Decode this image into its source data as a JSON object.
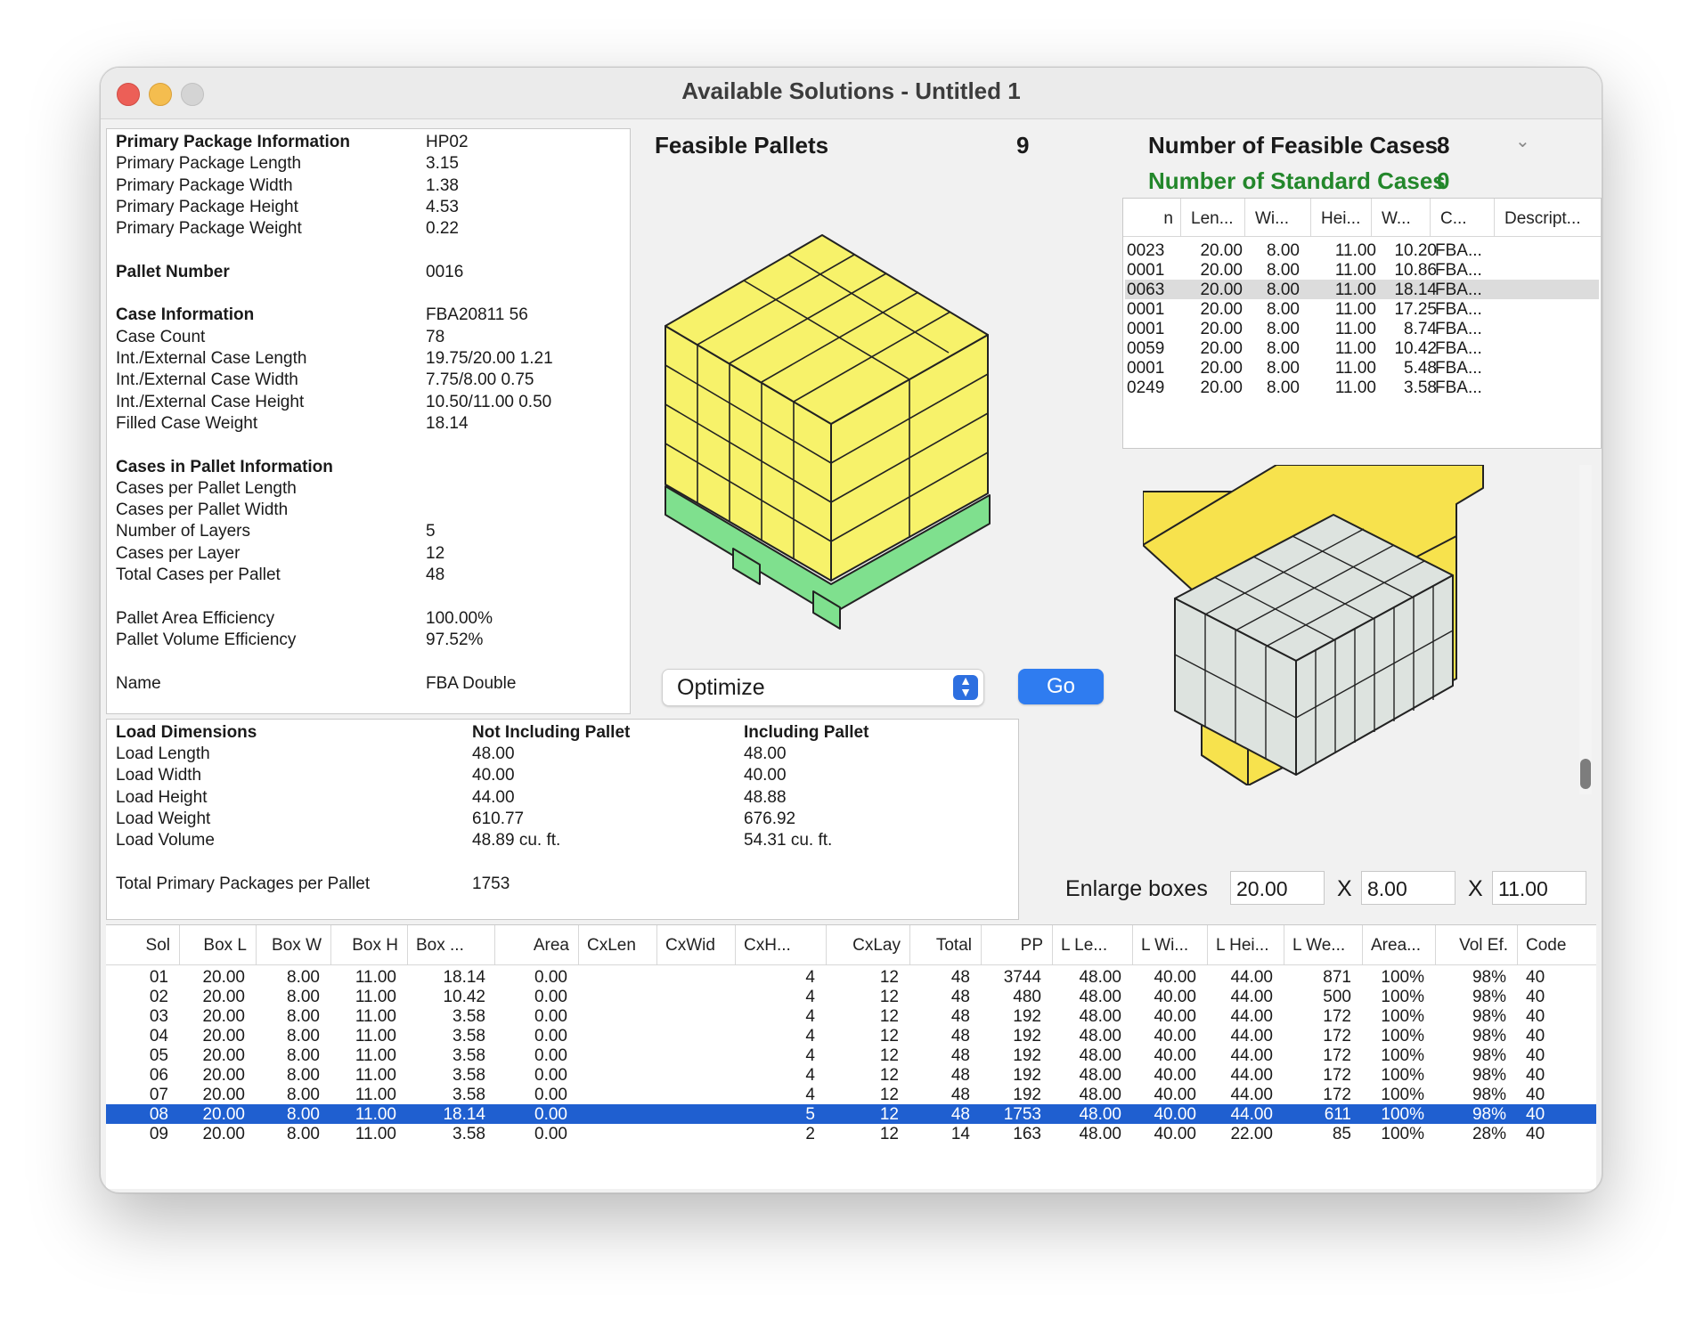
{
  "window": {
    "title": "Available Solutions - Untitled 1"
  },
  "info": [
    {
      "label": "Primary Package Information",
      "value": "HP02",
      "bold": true
    },
    {
      "label": "Primary Package Length",
      "value": "3.15"
    },
    {
      "label": "Primary Package Width",
      "value": "1.38"
    },
    {
      "label": "Primary Package Height",
      "value": "4.53"
    },
    {
      "label": "Primary Package Weight",
      "value": "0.22"
    },
    {
      "label": "",
      "value": ""
    },
    {
      "label": "Pallet Number",
      "value": "0016",
      "bold": true
    },
    {
      "label": "",
      "value": ""
    },
    {
      "label": "Case Information",
      "value": "FBA20811 56",
      "bold": true
    },
    {
      "label": "Case Count",
      "value": "78"
    },
    {
      "label": "Int./External Case Length",
      "value": "19.75/20.00   1.21"
    },
    {
      "label": "Int./External Case Width",
      "value": "7.75/8.00   0.75"
    },
    {
      "label": "Int./External Case Height",
      "value": "10.50/11.00   0.50"
    },
    {
      "label": "Filled Case Weight",
      "value": "18.14"
    },
    {
      "label": "",
      "value": ""
    },
    {
      "label": "Cases in Pallet Information",
      "value": "",
      "bold": true
    },
    {
      "label": "Cases per Pallet Length",
      "value": ""
    },
    {
      "label": "Cases per Pallet Width",
      "value": ""
    },
    {
      "label": "Number of Layers",
      "value": "5"
    },
    {
      "label": "Cases per Layer",
      "value": "12"
    },
    {
      "label": "Total Cases per Pallet",
      "value": "48"
    },
    {
      "label": "",
      "value": ""
    },
    {
      "label": "Pallet Area Efficiency",
      "value": "100.00%"
    },
    {
      "label": "Pallet Volume Efficiency",
      "value": "97.52%"
    },
    {
      "label": "",
      "value": ""
    },
    {
      "label": "Name",
      "value": "FBA Double"
    }
  ],
  "load": {
    "headers": [
      "Load Dimensions",
      "Not Including Pallet",
      "Including Pallet"
    ],
    "rows": [
      [
        "Load Length",
        "48.00",
        "48.00"
      ],
      [
        "Load Width",
        "40.00",
        "40.00"
      ],
      [
        "Load Height",
        "44.00",
        "48.88"
      ],
      [
        "Load Weight",
        "610.77",
        "676.92"
      ],
      [
        "Load Volume",
        "48.89 cu. ft.",
        "54.31 cu. ft."
      ],
      [
        "",
        "",
        ""
      ],
      [
        "Total Primary Packages per Pallet",
        "1753",
        ""
      ]
    ]
  },
  "feasible_pallets": {
    "label": "Feasible Pallets",
    "count": "9"
  },
  "feasible_cases": {
    "label": "Number of Feasible Cases",
    "count": "8"
  },
  "standard_cases": {
    "label": "Number of Standard Cases",
    "count": "0",
    "color": "#23872b"
  },
  "cases_table": {
    "headers": [
      "n",
      "Len...",
      "Wi...",
      "Hei...",
      "W...",
      "C...",
      "Descript..."
    ],
    "rows": [
      [
        "0023",
        "20.00",
        "8.00",
        "11.00",
        "10.20",
        "FBA..."
      ],
      [
        "0001",
        "20.00",
        "8.00",
        "11.00",
        "10.86",
        "FBA..."
      ],
      [
        "0063",
        "20.00",
        "8.00",
        "11.00",
        "18.14",
        "FBA..."
      ],
      [
        "0001",
        "20.00",
        "8.00",
        "11.00",
        "17.25",
        "FBA..."
      ],
      [
        "0001",
        "20.00",
        "8.00",
        "11.00",
        "8.74",
        "FBA..."
      ],
      [
        "0059",
        "20.00",
        "8.00",
        "11.00",
        "10.42",
        "FBA..."
      ],
      [
        "0001",
        "20.00",
        "8.00",
        "11.00",
        "5.48",
        "FBA..."
      ],
      [
        "0249",
        "20.00",
        "8.00",
        "11.00",
        "3.58",
        "FBA..."
      ]
    ],
    "selected_index": 2
  },
  "controls": {
    "mode": "Optimize",
    "go": "Go"
  },
  "enlarge": {
    "label": "Enlarge boxes",
    "x": "X",
    "length": "20.00",
    "width": "8.00",
    "height": "11.00"
  },
  "solutions": {
    "headers": [
      "Sol",
      "Box L",
      "Box W",
      "Box H",
      "Box ...",
      "Area",
      "CxLen",
      "CxWid",
      "CxH...",
      "CxLay",
      "Total",
      "PP",
      "L Le...",
      "L Wi...",
      "L Hei...",
      "L We...",
      "Area...",
      "Vol Ef.",
      "Code"
    ],
    "rows": [
      [
        "01",
        "20.00",
        "8.00",
        "11.00",
        "18.14",
        "0.00",
        "",
        "",
        "4",
        "12",
        "48",
        "3744",
        "48.00",
        "40.00",
        "44.00",
        "871",
        "100%",
        "98%",
        "40"
      ],
      [
        "02",
        "20.00",
        "8.00",
        "11.00",
        "10.42",
        "0.00",
        "",
        "",
        "4",
        "12",
        "48",
        "480",
        "48.00",
        "40.00",
        "44.00",
        "500",
        "100%",
        "98%",
        "40"
      ],
      [
        "03",
        "20.00",
        "8.00",
        "11.00",
        "3.58",
        "0.00",
        "",
        "",
        "4",
        "12",
        "48",
        "192",
        "48.00",
        "40.00",
        "44.00",
        "172",
        "100%",
        "98%",
        "40"
      ],
      [
        "04",
        "20.00",
        "8.00",
        "11.00",
        "3.58",
        "0.00",
        "",
        "",
        "4",
        "12",
        "48",
        "192",
        "48.00",
        "40.00",
        "44.00",
        "172",
        "100%",
        "98%",
        "40"
      ],
      [
        "05",
        "20.00",
        "8.00",
        "11.00",
        "3.58",
        "0.00",
        "",
        "",
        "4",
        "12",
        "48",
        "192",
        "48.00",
        "40.00",
        "44.00",
        "172",
        "100%",
        "98%",
        "40"
      ],
      [
        "06",
        "20.00",
        "8.00",
        "11.00",
        "3.58",
        "0.00",
        "",
        "",
        "4",
        "12",
        "48",
        "192",
        "48.00",
        "40.00",
        "44.00",
        "172",
        "100%",
        "98%",
        "40"
      ],
      [
        "07",
        "20.00",
        "8.00",
        "11.00",
        "3.58",
        "0.00",
        "",
        "",
        "4",
        "12",
        "48",
        "192",
        "48.00",
        "40.00",
        "44.00",
        "172",
        "100%",
        "98%",
        "40"
      ],
      [
        "08",
        "20.00",
        "8.00",
        "11.00",
        "18.14",
        "0.00",
        "",
        "",
        "5",
        "12",
        "48",
        "1753",
        "48.00",
        "40.00",
        "44.00",
        "611",
        "100%",
        "98%",
        "40"
      ],
      [
        "09",
        "20.00",
        "8.00",
        "11.00",
        "3.58",
        "0.00",
        "",
        "",
        "2",
        "12",
        "14",
        "163",
        "48.00",
        "40.00",
        "22.00",
        "85",
        "100%",
        "28%",
        "40"
      ]
    ],
    "selected_index": 7
  },
  "colors": {
    "case_yellow": "#f7f26a",
    "pallet_green": "#7fe08e",
    "box_gray": "#dde3df",
    "selection_blue": "#1f5fd0"
  }
}
